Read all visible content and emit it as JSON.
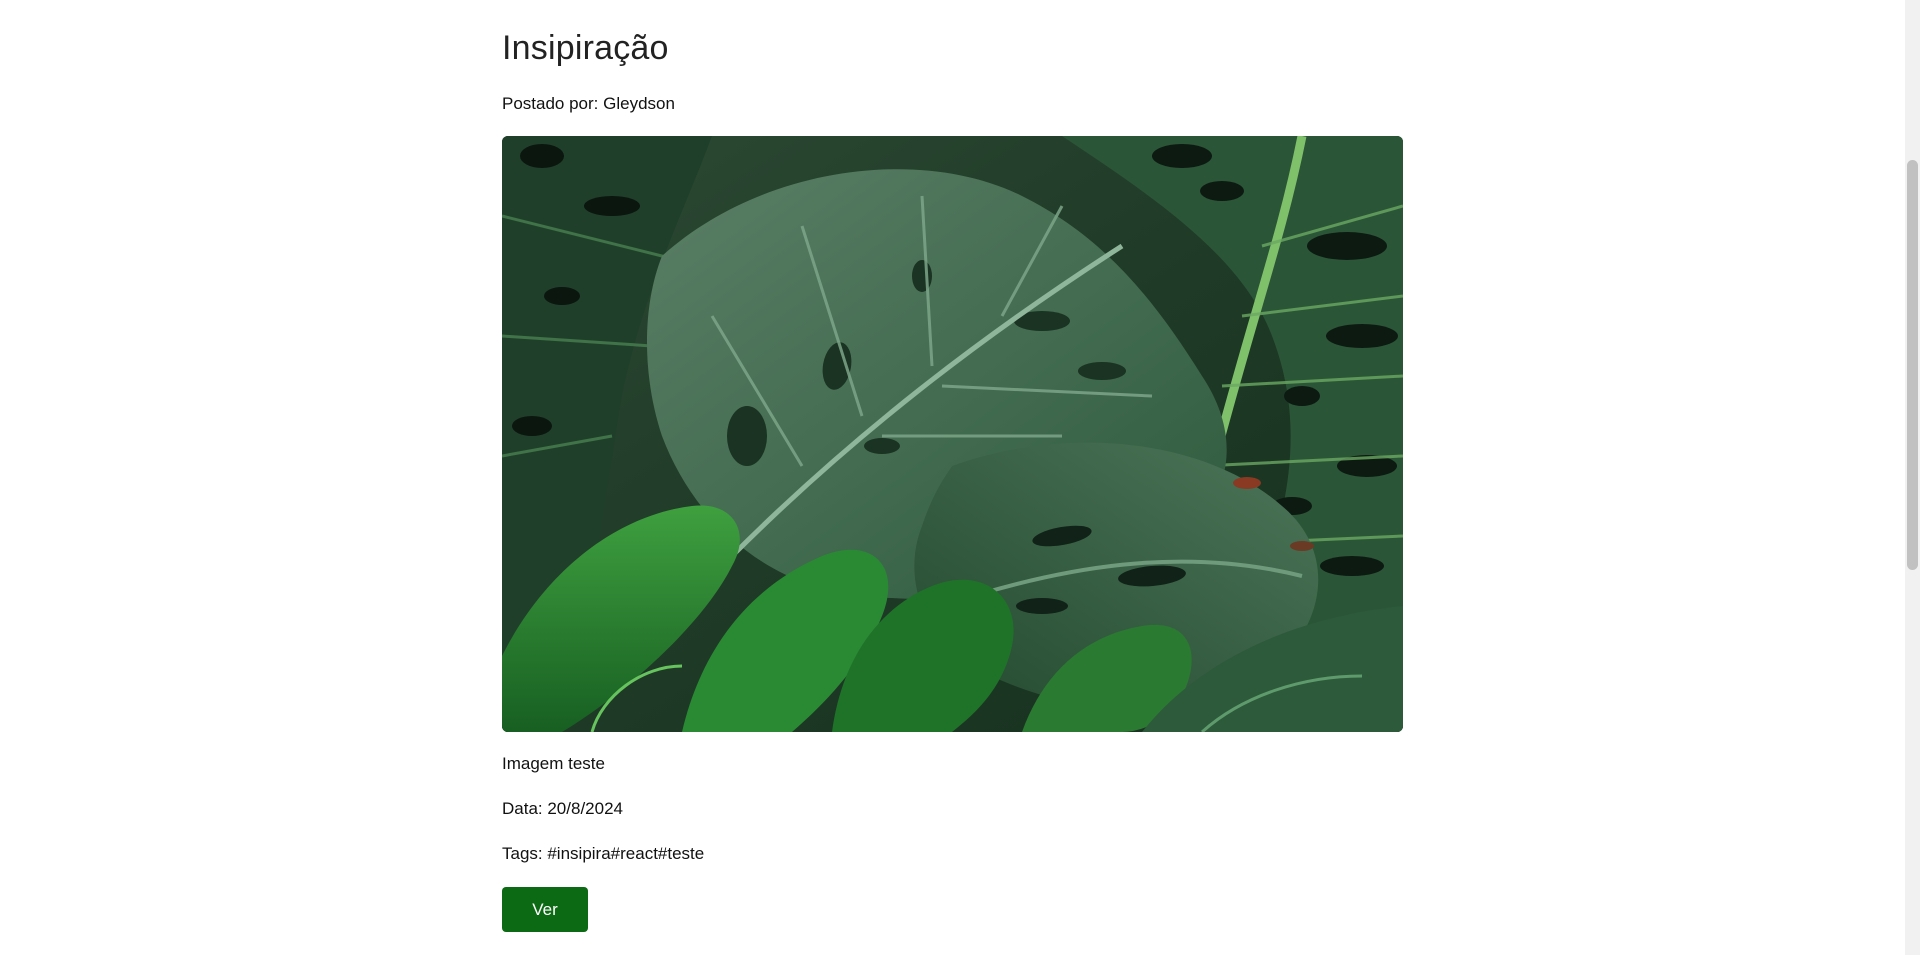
{
  "post": {
    "title": "Insipiração",
    "author": "Postado por: Gleydson",
    "image_alt": "Imagem teste",
    "caption": "Imagem teste",
    "date": "Data: 20/8/2024",
    "tags": "Tags: #insipira#react#teste",
    "view_label": "Ver"
  },
  "colors": {
    "button_bg": "#0c6a14",
    "button_text": "#ffffff",
    "text": "#111111",
    "leaf_dark": "#1e3b28",
    "leaf_mid": "#3f6b4e",
    "leaf_bright": "#2f8a35"
  }
}
